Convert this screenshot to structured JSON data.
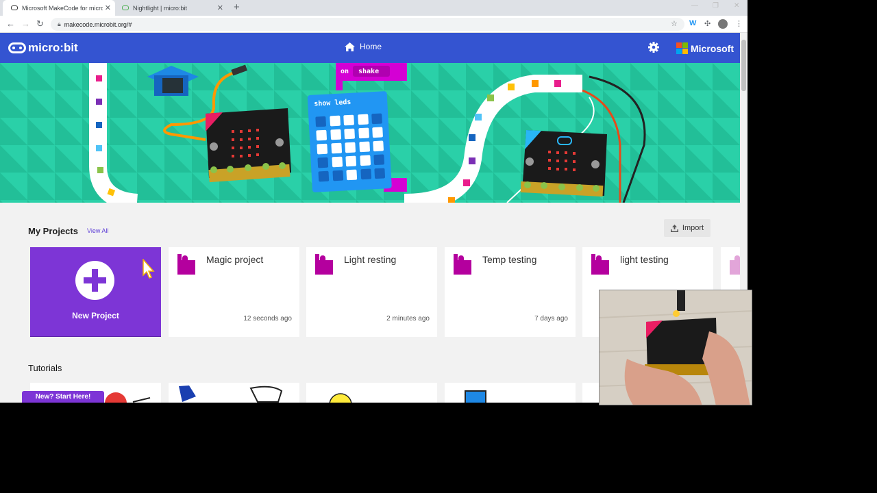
{
  "browser": {
    "tabs": [
      {
        "title": "Microsoft MakeCode for micro:bit",
        "active": true
      },
      {
        "title": "Nightlight | micro:bit",
        "active": false
      }
    ],
    "url": "makecode.microbit.org/#"
  },
  "app": {
    "logo_text": "micro:bit",
    "home_label": "Home",
    "microsoft_label": "Microsoft",
    "brand_color": "#3454d1"
  },
  "hero": {
    "block_event": "on",
    "block_event_value": "shake",
    "block_show_leds": "show leds"
  },
  "projects": {
    "title": "My Projects",
    "view_all": "View All",
    "import_label": "Import",
    "new_project_label": "New Project",
    "items": [
      {
        "name": "Magic project",
        "time": "12 seconds ago"
      },
      {
        "name": "Light resting",
        "time": "2 minutes ago"
      },
      {
        "name": "Temp testing",
        "time": "7 days ago"
      },
      {
        "name": "light testing",
        "time": ""
      }
    ]
  },
  "tutorials": {
    "title": "Tutorials",
    "new_start_label": "New? Start Here!"
  }
}
